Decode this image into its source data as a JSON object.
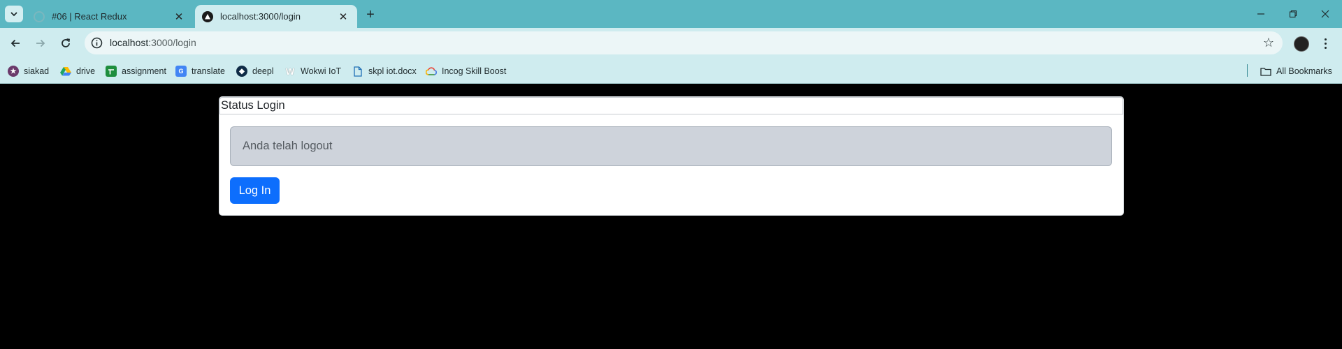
{
  "tabs": [
    {
      "title": "#06 | React Redux",
      "active": false
    },
    {
      "title": "localhost:3000/login",
      "active": true
    }
  ],
  "address_bar": {
    "host": "localhost",
    "path": ":3000/login"
  },
  "bookmarks": [
    {
      "label": "siakad",
      "icon": "siakad-icon",
      "color": "#6b3a6b"
    },
    {
      "label": "drive",
      "icon": "google-drive-icon",
      "color": "#1fa463"
    },
    {
      "label": "assignment",
      "icon": "google-sheets-icon",
      "color": "#1e8e3e"
    },
    {
      "label": "translate",
      "icon": "google-translate-icon",
      "color": "#4285f4"
    },
    {
      "label": "deepl",
      "icon": "deepl-icon",
      "color": "#0f2b46"
    },
    {
      "label": "Wokwi IoT",
      "icon": "wokwi-icon",
      "color": "#ffffff"
    },
    {
      "label": "skpl iot.docx",
      "icon": "document-icon",
      "color": "#ffffff"
    },
    {
      "label": "Incog Skill Boost",
      "icon": "google-cloud-icon",
      "color": "#ffffff"
    }
  ],
  "all_bookmarks_label": "All Bookmarks",
  "page": {
    "header": "Status Login",
    "status_message": "Anda telah logout",
    "login_button": "Log In"
  },
  "colors": {
    "tabstrip": "#5bb7c2",
    "toolbar": "#cfecef",
    "page_background": "#000000",
    "primary_button": "#0d6efd",
    "status_field": "#ced3db"
  }
}
